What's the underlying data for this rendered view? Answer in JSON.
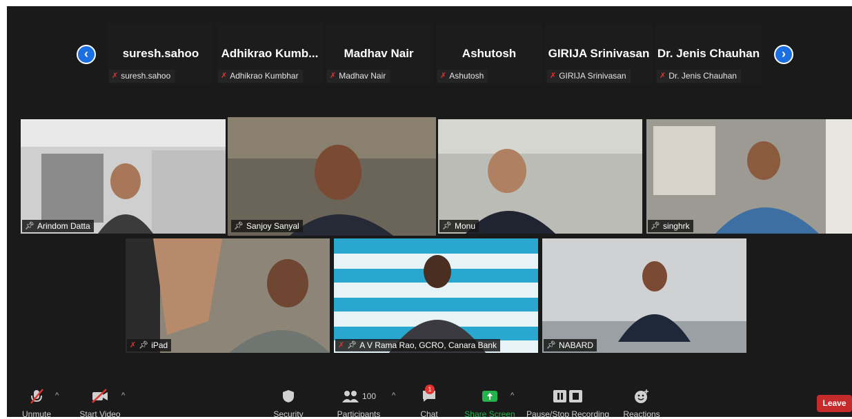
{
  "strip": {
    "participants": [
      {
        "display": "suresh.sahoo",
        "label": "suresh.sahoo"
      },
      {
        "display": "Adhikrao  Kumb...",
        "label": "Adhikrao Kumbhar"
      },
      {
        "display": "Madhav Nair",
        "label": "Madhav Nair"
      },
      {
        "display": "Ashutosh",
        "label": "Ashutosh"
      },
      {
        "display": "GIRIJA Srinivasan",
        "label": "GIRIJA Srinivasan"
      },
      {
        "display": "Dr. Jenis Chauhan",
        "label": "Dr. Jenis Chauhan"
      }
    ],
    "prev_icon": "chevron-left-icon",
    "next_icon": "chevron-right-icon"
  },
  "gallery": {
    "tiles": [
      {
        "label": "Arindom Datta",
        "pinned": true,
        "muted": false
      },
      {
        "label": "Sanjoy Sanyal",
        "pinned": true,
        "muted": false,
        "active_speaker": true
      },
      {
        "label": "Monu",
        "pinned": true,
        "muted": false
      },
      {
        "label": "singhrk",
        "pinned": true,
        "muted": false
      },
      {
        "label": "iPad",
        "pinned": true,
        "muted": true
      },
      {
        "label": "A V Rama Rao, GCRO, Canara Bank",
        "pinned": true,
        "muted": true
      },
      {
        "label": "NABARD",
        "pinned": true,
        "muted": false
      }
    ],
    "backdrop_brand": "Canara Bank"
  },
  "toolbar": {
    "unmute": "Unmute",
    "start_video": "Start Video",
    "security": "Security",
    "participants": "Participants",
    "participants_count": "100",
    "chat": "Chat",
    "chat_badge": "1",
    "share_screen": "Share Screen",
    "recording": "Pause/Stop Recording",
    "reactions": "Reactions",
    "leave": "Leave"
  },
  "colors": {
    "background": "#1a1a1a",
    "nav_blue": "#1b6fe0",
    "muted_red": "#e0332d",
    "share_green": "#25b34c",
    "active_speaker": "#d8e06a",
    "leave_red": "#c52b2b"
  }
}
